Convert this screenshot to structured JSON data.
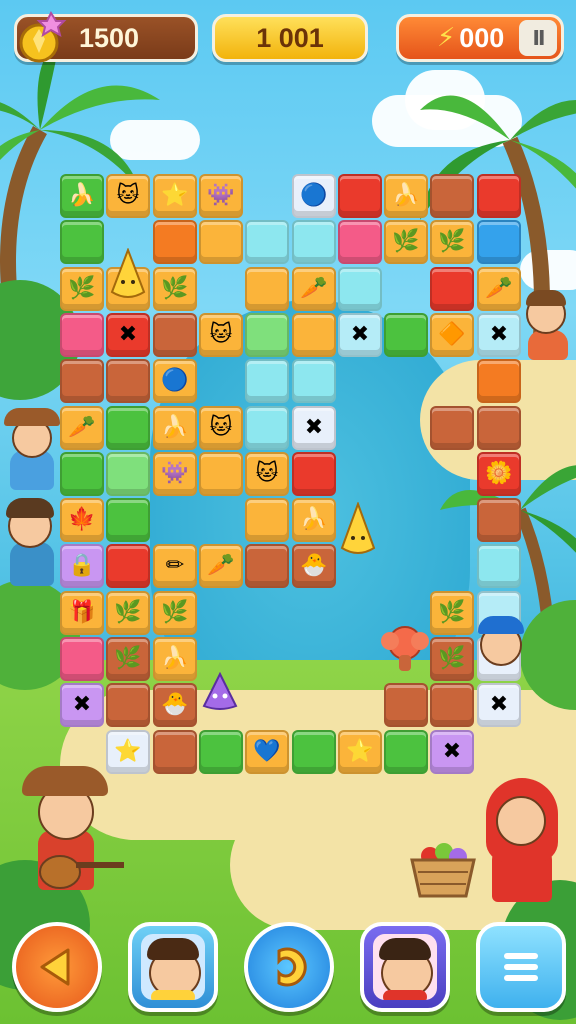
{
  "hud": {
    "coins": "1500",
    "score": "1 001",
    "energy": "000",
    "icons": {
      "coins": "gem-coin-icon",
      "energy": "lightning-bolt-icon",
      "pause": "pause-icon"
    }
  },
  "board": {
    "tiles": [
      {
        "c": 1,
        "r": 0,
        "color": "green",
        "icon": "🍌"
      },
      {
        "c": 2,
        "r": 0,
        "color": "orange",
        "icon": "🐱"
      },
      {
        "c": 3,
        "r": 0,
        "color": "orange",
        "icon": "⭐"
      },
      {
        "c": 4,
        "r": 0,
        "color": "orange",
        "icon": "👾"
      },
      {
        "c": 6,
        "r": 0,
        "color": "white",
        "icon": "🔵"
      },
      {
        "c": 7,
        "r": 0,
        "color": "red",
        "icon": ""
      },
      {
        "c": 8,
        "r": 0,
        "color": "orange",
        "icon": "🍌"
      },
      {
        "c": 9,
        "r": 0,
        "color": "brown",
        "icon": ""
      },
      {
        "c": 10,
        "r": 0,
        "color": "red",
        "icon": ""
      },
      {
        "c": 1,
        "r": 1,
        "color": "green",
        "icon": ""
      },
      {
        "c": 3,
        "r": 1,
        "color": "dorange",
        "icon": ""
      },
      {
        "c": 4,
        "r": 1,
        "color": "orange",
        "icon": ""
      },
      {
        "c": 5,
        "r": 1,
        "color": "cyan",
        "icon": ""
      },
      {
        "c": 6,
        "r": 1,
        "color": "cyan",
        "icon": ""
      },
      {
        "c": 7,
        "r": 1,
        "color": "pink",
        "icon": ""
      },
      {
        "c": 8,
        "r": 1,
        "color": "orange",
        "icon": "🌿"
      },
      {
        "c": 9,
        "r": 1,
        "color": "orange",
        "icon": "🌿"
      },
      {
        "c": 10,
        "r": 1,
        "color": "blue",
        "icon": ""
      },
      {
        "c": 1,
        "r": 2,
        "color": "orange",
        "icon": "🌿"
      },
      {
        "c": 2,
        "r": 2,
        "color": "orange",
        "icon": ""
      },
      {
        "c": 3,
        "r": 2,
        "color": "orange",
        "icon": "🌿"
      },
      {
        "c": 5,
        "r": 2,
        "color": "orange",
        "icon": ""
      },
      {
        "c": 6,
        "r": 2,
        "color": "orange",
        "icon": "🥕"
      },
      {
        "c": 7,
        "r": 2,
        "color": "cyan",
        "icon": ""
      },
      {
        "c": 9,
        "r": 2,
        "color": "red",
        "icon": ""
      },
      {
        "c": 10,
        "r": 2,
        "color": "orange",
        "icon": "🥕"
      },
      {
        "c": 1,
        "r": 3,
        "color": "pink",
        "icon": ""
      },
      {
        "c": 2,
        "r": 3,
        "color": "red",
        "icon": "✖"
      },
      {
        "c": 3,
        "r": 3,
        "color": "brown",
        "icon": ""
      },
      {
        "c": 4,
        "r": 3,
        "color": "orange",
        "icon": "🐱"
      },
      {
        "c": 5,
        "r": 3,
        "color": "lgreen",
        "icon": ""
      },
      {
        "c": 6,
        "r": 3,
        "color": "orange",
        "icon": ""
      },
      {
        "c": 7,
        "r": 3,
        "color": "lblue",
        "icon": "✖"
      },
      {
        "c": 8,
        "r": 3,
        "color": "green",
        "icon": ""
      },
      {
        "c": 9,
        "r": 3,
        "color": "orange",
        "icon": "🔶"
      },
      {
        "c": 10,
        "r": 3,
        "color": "lblue",
        "icon": "✖"
      },
      {
        "c": 1,
        "r": 4,
        "color": "brown",
        "icon": ""
      },
      {
        "c": 2,
        "r": 4,
        "color": "brown",
        "icon": ""
      },
      {
        "c": 3,
        "r": 4,
        "color": "orange",
        "icon": "🔵"
      },
      {
        "c": 5,
        "r": 4,
        "color": "cyan",
        "icon": ""
      },
      {
        "c": 6,
        "r": 4,
        "color": "cyan",
        "icon": ""
      },
      {
        "c": 10,
        "r": 4,
        "color": "dorange",
        "icon": ""
      },
      {
        "c": 1,
        "r": 5,
        "color": "orange",
        "icon": "🥕"
      },
      {
        "c": 2,
        "r": 5,
        "color": "green",
        "icon": ""
      },
      {
        "c": 3,
        "r": 5,
        "color": "orange",
        "icon": "🍌"
      },
      {
        "c": 4,
        "r": 5,
        "color": "orange",
        "icon": "🐱"
      },
      {
        "c": 5,
        "r": 5,
        "color": "cyan",
        "icon": ""
      },
      {
        "c": 6,
        "r": 5,
        "color": "white",
        "icon": "✖"
      },
      {
        "c": 9,
        "r": 5,
        "color": "brown",
        "icon": ""
      },
      {
        "c": 10,
        "r": 5,
        "color": "brown",
        "icon": ""
      },
      {
        "c": 1,
        "r": 6,
        "color": "green",
        "icon": ""
      },
      {
        "c": 2,
        "r": 6,
        "color": "lgreen",
        "icon": ""
      },
      {
        "c": 3,
        "r": 6,
        "color": "orange",
        "icon": "👾"
      },
      {
        "c": 4,
        "r": 6,
        "color": "orange",
        "icon": ""
      },
      {
        "c": 5,
        "r": 6,
        "color": "orange",
        "icon": "🐱"
      },
      {
        "c": 6,
        "r": 6,
        "color": "red",
        "icon": ""
      },
      {
        "c": 10,
        "r": 6,
        "color": "red",
        "icon": "🌼"
      },
      {
        "c": 1,
        "r": 7,
        "color": "orange",
        "icon": "🍁"
      },
      {
        "c": 2,
        "r": 7,
        "color": "green",
        "icon": ""
      },
      {
        "c": 5,
        "r": 7,
        "color": "orange",
        "icon": ""
      },
      {
        "c": 6,
        "r": 7,
        "color": "orange",
        "icon": "🍌"
      },
      {
        "c": 10,
        "r": 7,
        "color": "brown",
        "icon": ""
      },
      {
        "c": 1,
        "r": 8,
        "color": "purple",
        "icon": "🔒"
      },
      {
        "c": 2,
        "r": 8,
        "color": "red",
        "icon": ""
      },
      {
        "c": 3,
        "r": 8,
        "color": "orange",
        "icon": "✏"
      },
      {
        "c": 4,
        "r": 8,
        "color": "orange",
        "icon": "🥕"
      },
      {
        "c": 5,
        "r": 8,
        "color": "brown",
        "icon": ""
      },
      {
        "c": 6,
        "r": 8,
        "color": "brown",
        "icon": "🐣"
      },
      {
        "c": 10,
        "r": 8,
        "color": "cyan",
        "icon": ""
      },
      {
        "c": 1,
        "r": 9,
        "color": "orange",
        "icon": "🎁"
      },
      {
        "c": 2,
        "r": 9,
        "color": "orange",
        "icon": "🌿"
      },
      {
        "c": 3,
        "r": 9,
        "color": "orange",
        "icon": "🌿"
      },
      {
        "c": 9,
        "r": 9,
        "color": "orange",
        "icon": "🌿"
      },
      {
        "c": 10,
        "r": 9,
        "color": "lblue",
        "icon": ""
      },
      {
        "c": 1,
        "r": 10,
        "color": "pink",
        "icon": ""
      },
      {
        "c": 2,
        "r": 10,
        "color": "brown",
        "icon": "🌿"
      },
      {
        "c": 3,
        "r": 10,
        "color": "orange",
        "icon": "🍌"
      },
      {
        "c": 9,
        "r": 10,
        "color": "brown",
        "icon": "🌿"
      },
      {
        "c": 10,
        "r": 10,
        "color": "white",
        "icon": ""
      },
      {
        "c": 1,
        "r": 11,
        "color": "purple",
        "icon": "✖"
      },
      {
        "c": 2,
        "r": 11,
        "color": "brown",
        "icon": ""
      },
      {
        "c": 3,
        "r": 11,
        "color": "brown",
        "icon": "🐣"
      },
      {
        "c": 8,
        "r": 11,
        "color": "brown",
        "icon": ""
      },
      {
        "c": 9,
        "r": 11,
        "color": "brown",
        "icon": ""
      },
      {
        "c": 10,
        "r": 11,
        "color": "white",
        "icon": "✖"
      },
      {
        "c": 2,
        "r": 12,
        "color": "white",
        "icon": "⭐"
      },
      {
        "c": 3,
        "r": 12,
        "color": "brown",
        "icon": ""
      },
      {
        "c": 4,
        "r": 12,
        "color": "green",
        "icon": ""
      },
      {
        "c": 5,
        "r": 12,
        "color": "orange",
        "icon": "💙"
      },
      {
        "c": 6,
        "r": 12,
        "color": "green",
        "icon": ""
      },
      {
        "c": 7,
        "r": 12,
        "color": "orange",
        "icon": "⭐"
      },
      {
        "c": 8,
        "r": 12,
        "color": "green",
        "icon": ""
      },
      {
        "c": 9,
        "r": 12,
        "color": "purple",
        "icon": "✖"
      }
    ],
    "free_pieces": [
      {
        "icon": "🔺",
        "name": "cone-piece-top"
      },
      {
        "icon": "🔺",
        "name": "cone-piece-water"
      },
      {
        "icon": "🦑",
        "name": "purple-creature"
      },
      {
        "icon": "🍄",
        "name": "flower-creature"
      }
    ]
  },
  "controls": {
    "back": "back-arrow-icon",
    "player1": "player-avatar-boy",
    "end_turn": "turn-arrow-icon",
    "player2": "player-avatar-girl",
    "menu": "menu-icon"
  },
  "colors": {
    "green": "#4cc23f",
    "lgreen": "#7fe07c",
    "orange": "#fbb43a",
    "dorange": "#f47b22",
    "red": "#ea3a2c",
    "pink": "#f45b88",
    "brown": "#c9653a",
    "cyan": "#8de7ef",
    "lblue": "#b5ecf7",
    "white": "#e8f0fb",
    "purple": "#c996f2",
    "blue": "#34a2ec"
  }
}
